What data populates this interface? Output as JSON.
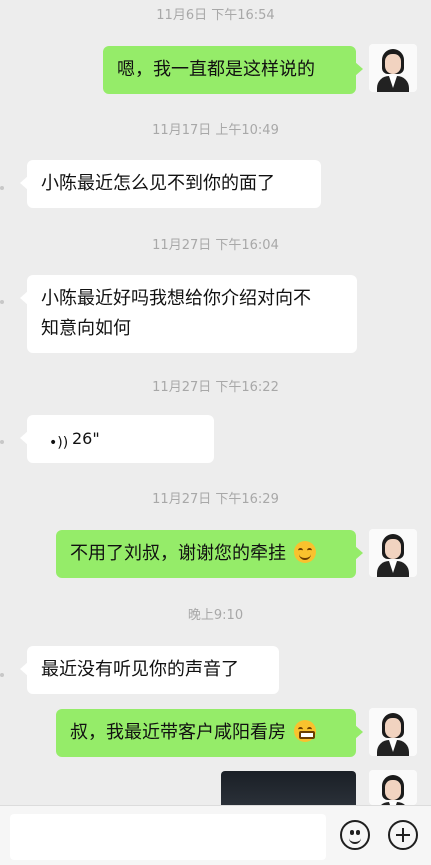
{
  "messages": {
    "ts1": "11月6日 下午16:54",
    "m1": "嗯，我一直都是这样说的",
    "ts2": "11月17日 上午10:49",
    "m2": "小陈最近怎么见不到你的面了",
    "ts3": "11月27日 下午16:04",
    "m3_line1": "小陈最近好吗我想给你介绍对向不",
    "m3_line2": "知意向如何",
    "ts4": "11月27日 下午16:22",
    "m4_voice": "26\"",
    "ts5": "11月27日 下午16:29",
    "m5": "不用了刘叔，谢谢您的牵挂",
    "ts6": "晚上9:10",
    "m6": "最近没有听见你的声音了",
    "m7": "叔，我最近带客户咸阳看房"
  },
  "colors": {
    "background": "#ededed",
    "outgoing_bubble": "#95ec69",
    "incoming_bubble": "#ffffff",
    "timestamp": "#a8a8a8"
  },
  "icons": {
    "voice": "voice-wave-icon",
    "emoji": "emoji-icon",
    "plus": "plus-icon"
  }
}
